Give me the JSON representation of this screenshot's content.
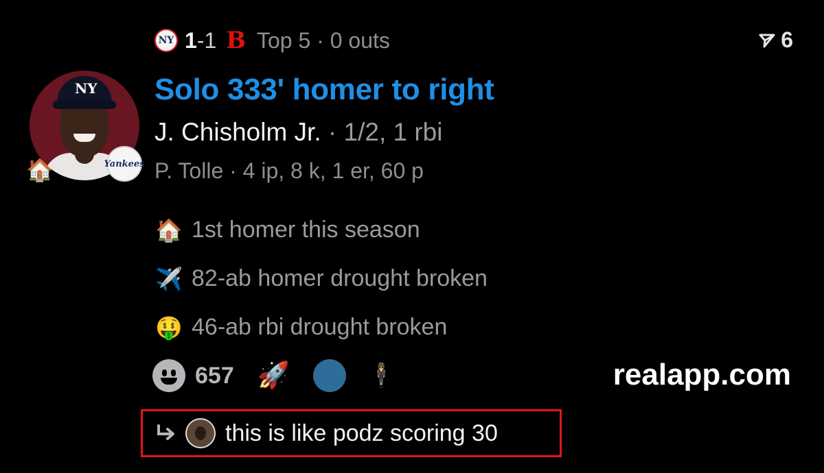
{
  "header": {
    "away_team_icon": "yankees-logo",
    "away_score": "1",
    "score_separator": "-1",
    "home_team_icon": "red-sox-logo",
    "home_logo_text": "B",
    "inning": "Top 5 · 0 outs",
    "views_icon": "send-icon",
    "views_count": "6"
  },
  "play": {
    "title": "Solo 333' homer to right",
    "batter_name": "J. Chisholm Jr.",
    "batter_stat": " · 1/2, 1 rbi",
    "pitcher_line": "P. Tolle · 4 ip, 8 k, 1 er, 60 p",
    "avatar_badge_icon": "house-icon",
    "team_badge_text": "Yankees"
  },
  "notes": [
    {
      "icon": "🏠",
      "icon_name": "house-icon",
      "text": "1st homer this season"
    },
    {
      "icon": "✈️",
      "icon_name": "airplane-icon",
      "text": "82-ab homer drought broken"
    },
    {
      "icon": "🤑",
      "icon_name": "money-face-icon",
      "text": "46-ab rbi drought broken"
    }
  ],
  "reactions": {
    "count": "657",
    "rocket": "🚀",
    "person": "🕴"
  },
  "brand": "realapp.com",
  "reply": {
    "text": "this is like podz scoring 30"
  },
  "colors": {
    "title_blue": "#1f8fe6",
    "highlight_border": "#e0161c",
    "background": "#000000"
  }
}
